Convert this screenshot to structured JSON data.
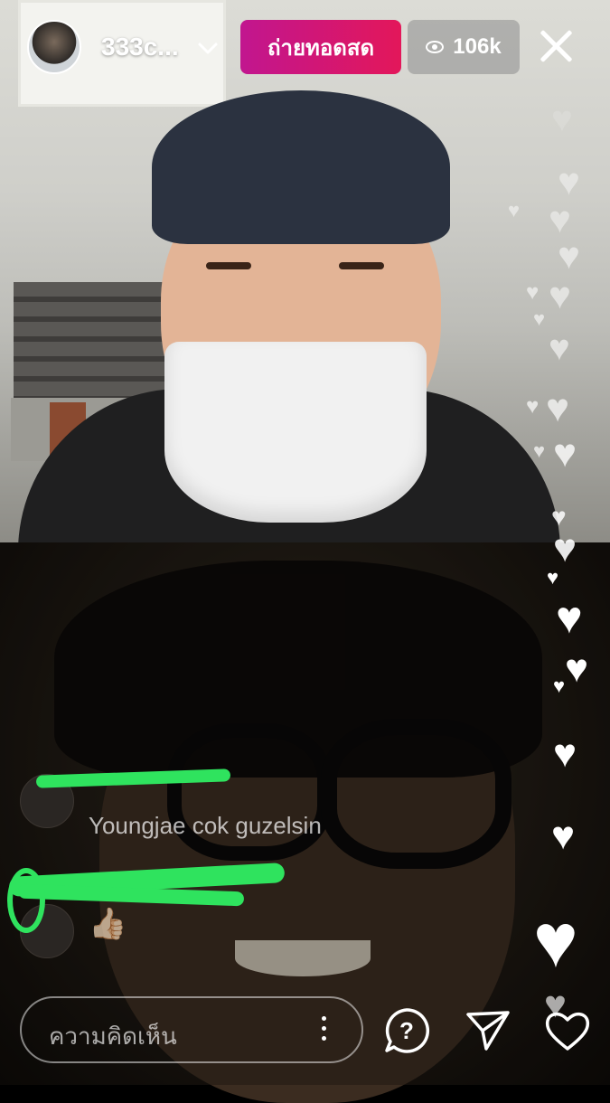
{
  "header": {
    "username": "333c...",
    "live_label": "ถ่ายทอดสด",
    "viewer_count": "106k",
    "icons": [
      "avatar",
      "chevron-down-icon",
      "eye-icon",
      "close-icon"
    ]
  },
  "comments": [
    {
      "text": "Youngjae cok guzelsin"
    },
    {
      "text": "👍🏻"
    }
  ],
  "composer": {
    "placeholder": "ความคิดเห็น"
  },
  "actions": [
    "question-icon",
    "send-icon",
    "heart-icon"
  ],
  "colors": {
    "live_badge_start": "#c1168f",
    "live_badge_end": "#e3175a",
    "scribble": "#2fe35e"
  }
}
